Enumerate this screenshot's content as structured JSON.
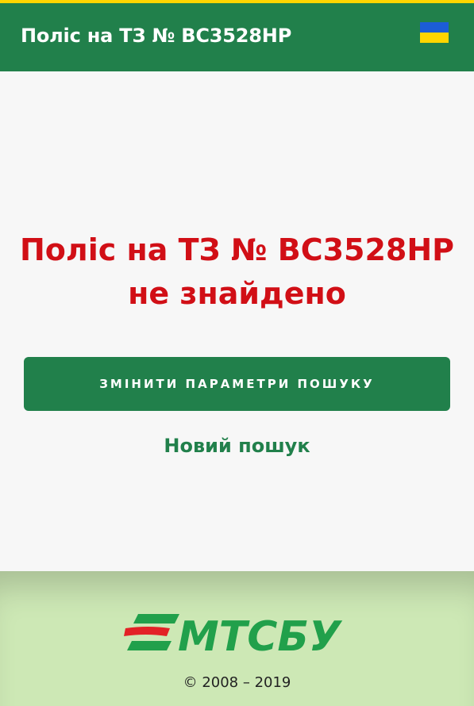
{
  "header": {
    "title": "Поліс на ТЗ № ВС3528НР",
    "flag_icon": "ukraine-flag-icon"
  },
  "main": {
    "not_found_message": "Поліс на ТЗ № ВС3528НР не знайдено",
    "change_params_button": "ЗМІНИТИ ПАРАМЕТРИ ПОШУКУ",
    "new_search_link": "Новий пошук"
  },
  "footer": {
    "logo_text": "МТСБУ",
    "copyright": "© 2008 – 2019"
  },
  "colors": {
    "header_bg": "#21804b",
    "top_line": "#ffd500",
    "error_text": "#d10f16",
    "button_bg": "#21804b",
    "footer_bg": "#cde8b5",
    "logo_red": "#e32226",
    "logo_green": "#21a04b"
  }
}
